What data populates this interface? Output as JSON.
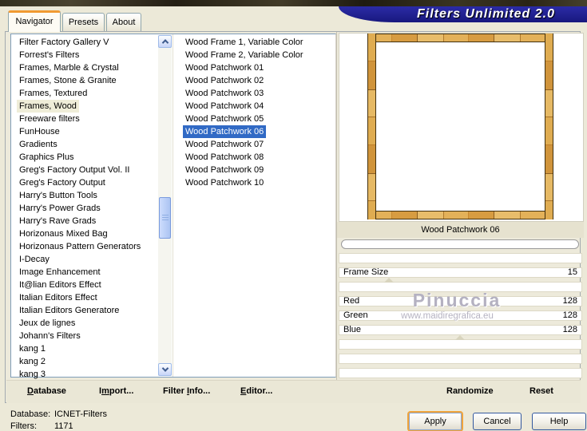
{
  "banner": {
    "title": "Filters Unlimited 2.0"
  },
  "tabs": {
    "navigator": "Navigator",
    "presets": "Presets",
    "about": "About"
  },
  "categories": {
    "items": [
      "Filter Factory Gallery V",
      "Forrest's Filters",
      "Frames, Marble & Crystal",
      "Frames, Stone & Granite",
      "Frames, Textured",
      "Frames, Wood",
      "Freeware filters",
      "FunHouse",
      "Gradients",
      "Graphics Plus",
      "Greg's Factory Output Vol. II",
      "Greg's Factory Output",
      "Harry's Button Tools",
      "Harry's Power Grads",
      "Harry's Rave Grads",
      "Horizonaus Mixed Bag",
      "Horizonaus Pattern Generators",
      "I-Decay",
      "Image Enhancement",
      "It@lian Editors Effect",
      "Italian Editors Effect",
      "Italian Editors Generatore",
      "Jeux de lignes",
      "Johann's Filters",
      "kang 1",
      "kang 2",
      "kang 3"
    ],
    "highlighted_index": 5
  },
  "filters": {
    "items": [
      "Wood Frame 1, Variable Color",
      "Wood Frame 2, Variable Color",
      "Wood Patchwork 01",
      "Wood Patchwork 02",
      "Wood Patchwork 03",
      "Wood Patchwork 04",
      "Wood Patchwork 05",
      "Wood Patchwork 06",
      "Wood Patchwork 07",
      "Wood Patchwork 08",
      "Wood Patchwork 09",
      "Wood Patchwork 10"
    ],
    "selected_index": 7
  },
  "preview": {
    "caption": "Wood Patchwork 06"
  },
  "parameters": [
    {
      "label": "Frame Size",
      "value": "15"
    },
    {
      "label": "Red",
      "value": "128"
    },
    {
      "label": "Green",
      "value": "128"
    },
    {
      "label": "Blue",
      "value": "128"
    }
  ],
  "watermark": {
    "name": "Pinuccia",
    "url": "www.maidiregrafica.eu"
  },
  "menu": {
    "database": {
      "accel": "D",
      "post": "atabase"
    },
    "import": {
      "pre": "I",
      "accel": "m",
      "post": "port..."
    },
    "filter_info": {
      "pre": "Filter ",
      "accel": "I",
      "post": "nfo..."
    },
    "editor": {
      "accel": "E",
      "post": "ditor..."
    }
  },
  "panel_actions": {
    "randomize": "Randomize",
    "reset": "Reset"
  },
  "status": {
    "database_label": "Database:",
    "database_value": "ICNET-Filters",
    "filters_label": "Filters:",
    "filters_value": "1171"
  },
  "buttons": {
    "apply": "Apply",
    "cancel": "Cancel",
    "help": "Help"
  },
  "colors": {
    "selection": "#316AC5",
    "banner_blue": "#20208E",
    "tab_accent": "#F09A32",
    "background": "#ECE9D8"
  }
}
